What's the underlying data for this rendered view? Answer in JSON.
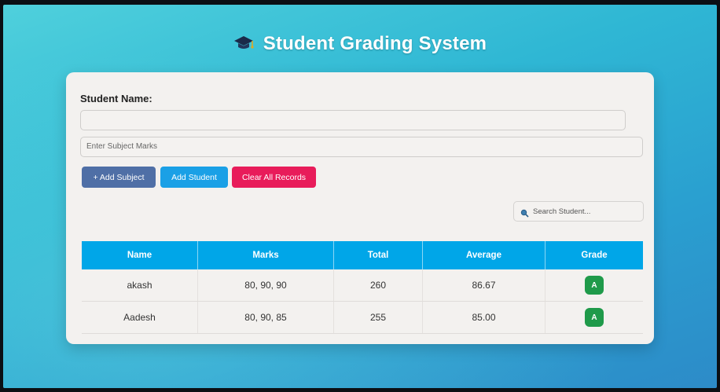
{
  "app": {
    "title": "Student Grading System",
    "title_icon": "graduation-cap-icon"
  },
  "form": {
    "student_name_label": "Student Name:",
    "student_name_value": "",
    "subject_marks_placeholder": "Enter Subject Marks"
  },
  "buttons": {
    "add_subject": "+ Add Subject",
    "add_student": "Add Student",
    "clear_all": "Clear All Records"
  },
  "search": {
    "icon": "search-icon",
    "placeholder": "Search Student..."
  },
  "table": {
    "headers": [
      "Name",
      "Marks",
      "Total",
      "Average",
      "Grade"
    ],
    "rows": [
      {
        "name": "akash",
        "marks": "80, 90, 90",
        "total": "260",
        "average": "86.67",
        "grade": "A"
      },
      {
        "name": "Aadesh",
        "marks": "80, 90, 85",
        "total": "255",
        "average": "85.00",
        "grade": "A"
      }
    ]
  },
  "colors": {
    "background_top": "#4fd0dc",
    "background_bottom": "#2d8bc8",
    "header": "#00a6e8",
    "add_subject": "#4f6fa6",
    "add_student": "#1aa0e6",
    "clear_all": "#e81c5a",
    "grade_badge": "#1f9a4a"
  }
}
